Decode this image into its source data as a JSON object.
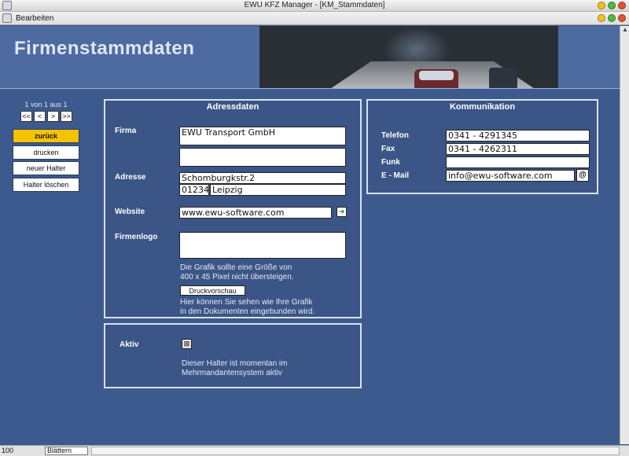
{
  "window": {
    "title": "EWU KFZ Manager - [KM_Stammdaten]"
  },
  "menu": {
    "edit": "Bearbeiten"
  },
  "header": {
    "title": "Firmenstammdaten"
  },
  "nav": {
    "record_info": "1 von 1 aus 1",
    "pager": [
      "<<",
      "<",
      ">",
      ">>"
    ],
    "buttons": [
      "zurück",
      "drucken",
      "neuer Halter",
      "Halter löschen"
    ]
  },
  "address": {
    "title": "Adressdaten",
    "firma_label": "Firma",
    "firma_value": "EWU Transport GmbH",
    "firma2_value": "",
    "adresse_label": "Adresse",
    "street": "Schomburgkstr.2",
    "zip": "01234",
    "city": "Leipzig",
    "website_label": "Website",
    "website": "www.ewu-software.com",
    "logo_label": "Firmenlogo",
    "logo_hint_1": "Die Grafik sollte eine Größe von",
    "logo_hint_2": "400 x 45 Pixel nicht übersteigen.",
    "preview_button": "Druckvorschau",
    "preview_hint_1": "Hier können Sie sehen wie Ihre Grafik",
    "preview_hint_2": "in den Dokumenten eingebunden wird."
  },
  "status": {
    "aktiv_label": "Aktiv",
    "checked": true,
    "info_1": "Dieser Halter ist momentan im",
    "info_2": "Mehrmandantensystem aktiv"
  },
  "communication": {
    "title": "Kommunikation",
    "telefon_label": "Telefon",
    "telefon": "0341 - 4291345",
    "fax_label": "Fax",
    "fax": "0341 - 4262311",
    "funk_label": "Funk",
    "funk": "",
    "email_label": "E - Mail",
    "email": "info@ewu-software.com",
    "email_icon": "@"
  },
  "statusbar": {
    "zoom": "100",
    "mode": "Blättern"
  },
  "colors": {
    "background": "#3c5a8e",
    "panel": "#3b5587",
    "active_button": "#f6c200"
  }
}
